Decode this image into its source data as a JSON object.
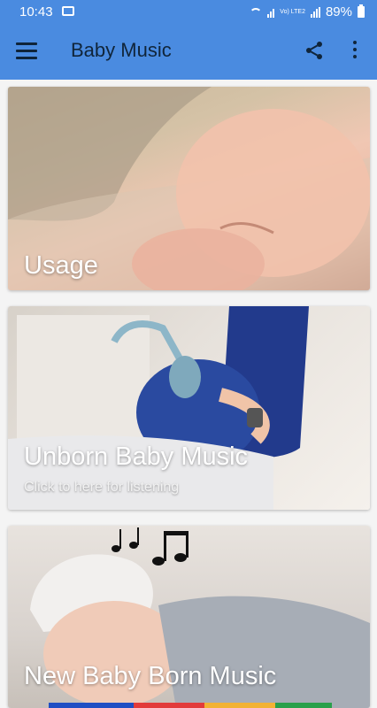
{
  "status_bar": {
    "time": "10:43",
    "volte": "Vo) LTE2",
    "battery": "89%"
  },
  "app_bar": {
    "title": "Baby Music",
    "menu_icon": "menu-icon",
    "share_icon": "share-icon",
    "more_icon": "more-vert-icon"
  },
  "cards": [
    {
      "title": "Usage"
    },
    {
      "title": "Unborn Baby Music",
      "subtitle": "Click to here for listening"
    },
    {
      "title": "New Baby Born Music"
    }
  ],
  "colors": {
    "app_bar": "#4a8be0",
    "text_on_card": "#ffffff"
  }
}
